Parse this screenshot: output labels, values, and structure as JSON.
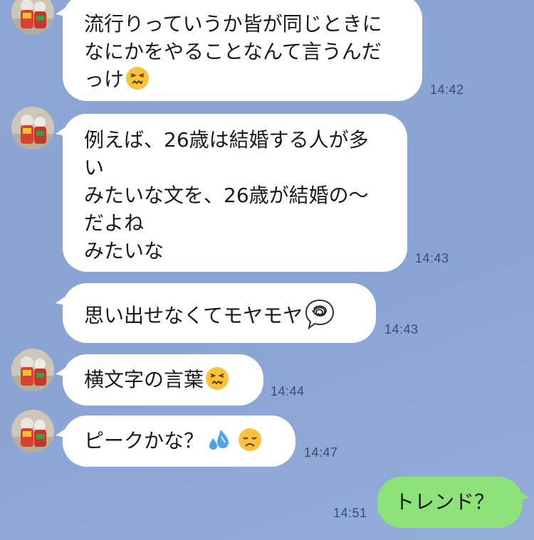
{
  "messages": [
    {
      "lines": [
        "流行りっていうか皆が同じときに",
        "なにかをやることなんて言うんだ",
        "っけ"
      ],
      "time": "14:42",
      "icon": "confounded-face-icon"
    },
    {
      "lines": [
        "例えば、26歳は結婚する人が多",
        "い",
        "みたいな文を、26歳が結婚の〜",
        "だよね",
        "みたいな"
      ],
      "time": "14:43"
    },
    {
      "lines": [
        "思い出せなくてモヤモヤ"
      ],
      "time": "14:43",
      "icon": "tangled-thought-bubble-icon"
    },
    {
      "lines": [
        "横文字の言葉"
      ],
      "time": "14:44",
      "icon": "confounded-face-icon"
    },
    {
      "lines": [
        "ピークかな？"
      ],
      "time": "14:47",
      "icons": [
        "sweat-droplets-icon",
        "disappointed-face-icon"
      ]
    },
    {
      "lines": [
        "トレンド？"
      ],
      "time": "14:51",
      "outgoing": true
    }
  ],
  "colors": {
    "background": "#8ca6d6",
    "incoming_bubble": "#ffffff",
    "outgoing_bubble": "#8de27a",
    "timestamp": "#3b4d6e"
  }
}
